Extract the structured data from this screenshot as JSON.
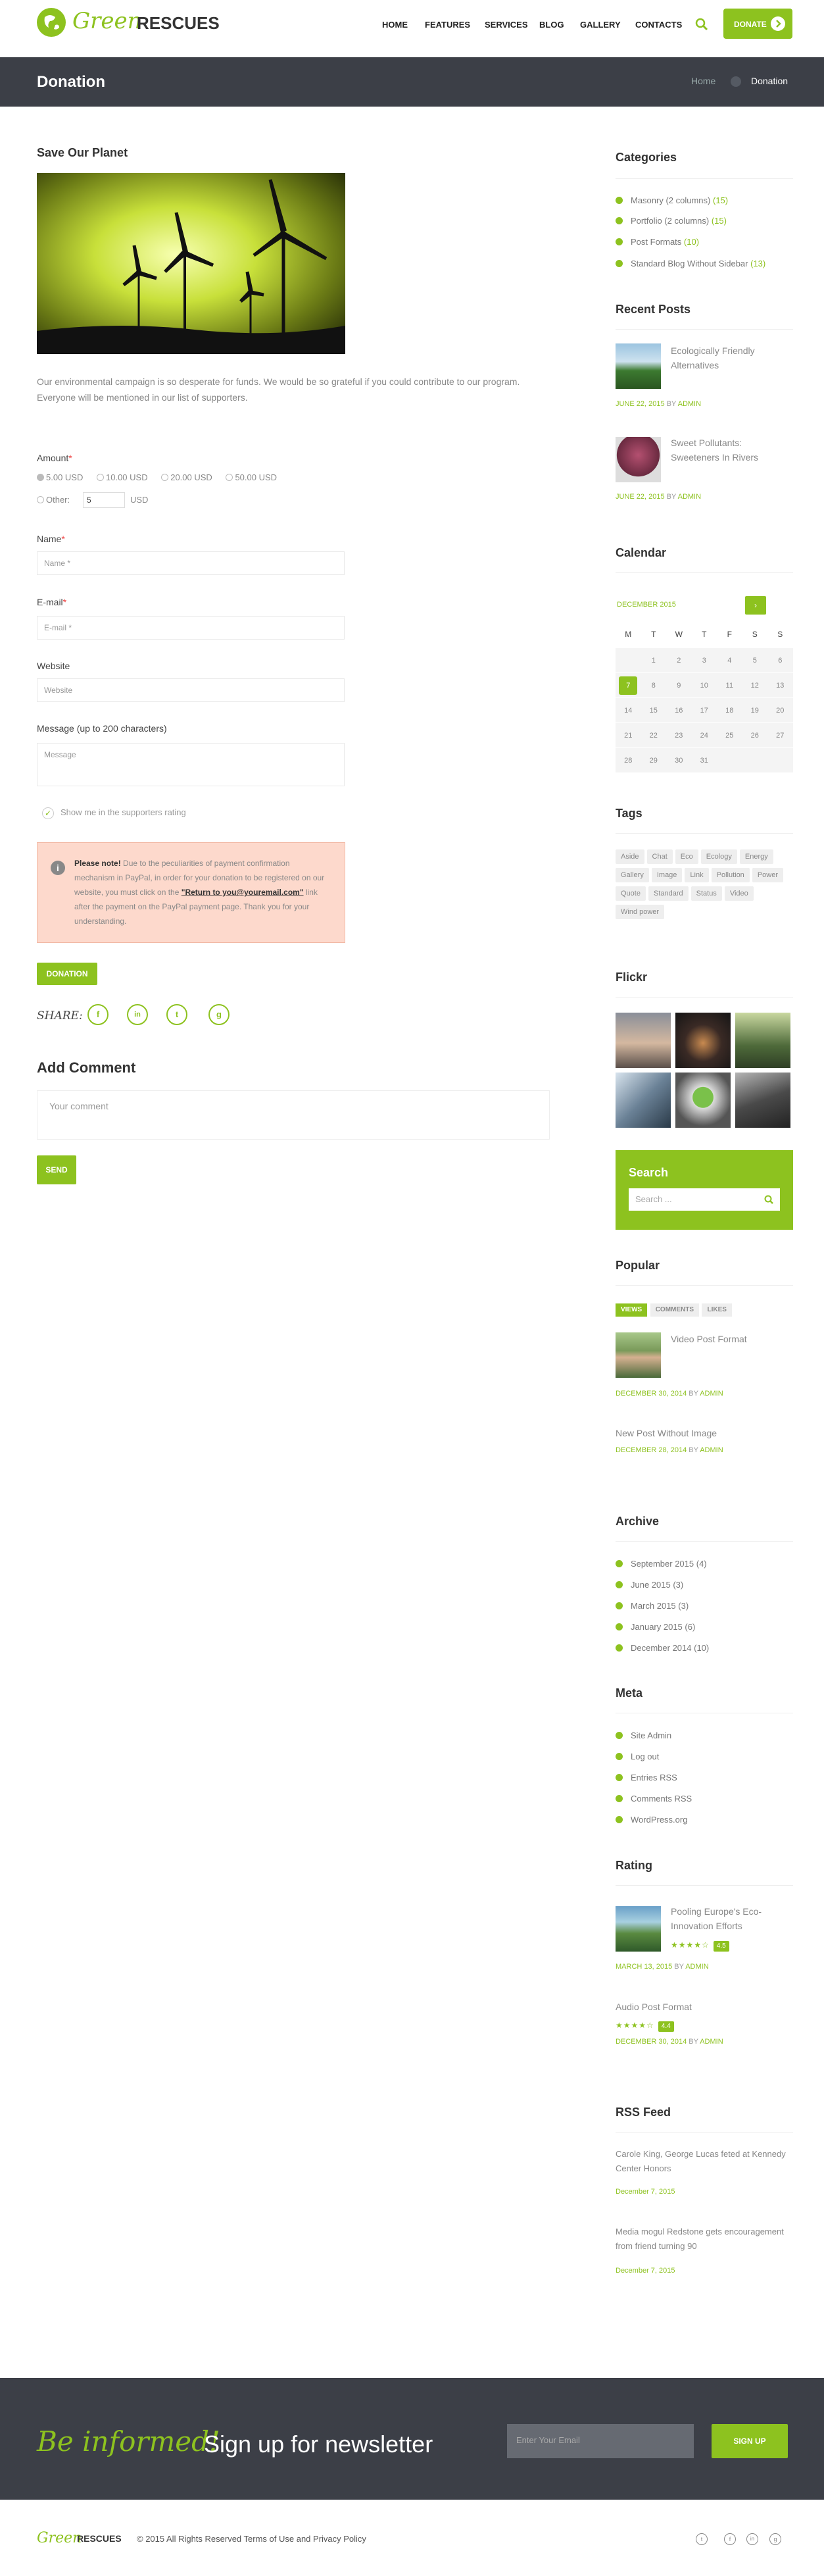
{
  "header": {
    "logo_green": "Green",
    "logo_dark": "RESCUES",
    "nav": [
      "HOME",
      "FEATURES",
      "SERVICES",
      "BLOG",
      "GALLERY",
      "CONTACTS"
    ],
    "donate_label": "DONATE"
  },
  "titlebar": {
    "title": "Donation",
    "breadcrumb_home": "Home",
    "breadcrumb_current": "Donation"
  },
  "main": {
    "heading": "Save Our Planet",
    "intro": "Our environmental campaign is so desperate for funds. We would be so grateful if you could contribute to our program. Everyone will be mentioned in our list of supporters.",
    "amount_label": "Amount",
    "amount_options": [
      "5.00 USD",
      "10.00 USD",
      "20.00 USD",
      "50.00 USD"
    ],
    "other_label": "Other:",
    "other_value": "5",
    "other_unit": "USD",
    "name_label": "Name",
    "name_placeholder": "Name *",
    "email_label": "E-mail",
    "email_placeholder": "E-mail *",
    "website_label": "Website",
    "website_placeholder": "Website",
    "message_label": "Message (up to 200 characters)",
    "message_placeholder": "Message",
    "checkbox_label": "Show me in the supporters rating",
    "notice_bold": "Please note!",
    "notice_text_1": " Due to the peculiarities of payment confirmation mechanism in PayPal, in order for your donation to be registered on our website, you must click on the ",
    "notice_link": "\"Return to you@youremail.com\"",
    "notice_text_2": " link after the payment on the PayPal payment page. Thank you for your understanding.",
    "donation_button": "DONATION",
    "share_label": "SHARE:",
    "share_icons": [
      "f",
      "in",
      "t",
      "g"
    ],
    "add_comment_title": "Add Comment",
    "comment_placeholder": "Your comment",
    "send_button": "SEND"
  },
  "sidebar": {
    "categories_title": "Categories",
    "categories": [
      {
        "name": "Masonry (2 columns)",
        "count": "(15)"
      },
      {
        "name": "Portfolio (2 columns)",
        "count": "(15)"
      },
      {
        "name": "Post Formats",
        "count": "(10)"
      },
      {
        "name": "Standard Blog Without Sidebar",
        "count": "(13)"
      }
    ],
    "recent_title": "Recent Posts",
    "recent": [
      {
        "title": "Ecologically Friendly Alternatives",
        "date": "JUNE 22, 2015",
        "by": "BY",
        "author": "ADMIN"
      },
      {
        "title": "Sweet Pollutants: Sweeteners In Rivers",
        "date": "JUNE 22, 2015",
        "by": "BY",
        "author": "ADMIN"
      }
    ],
    "calendar_title": "Calendar",
    "calendar_month": "DECEMBER 2015",
    "calendar_days": [
      "M",
      "T",
      "W",
      "T",
      "F",
      "S",
      "S"
    ],
    "calendar_rows": [
      [
        "",
        "1",
        "2",
        "3",
        "4",
        "5",
        "6"
      ],
      [
        "7",
        "8",
        "9",
        "10",
        "11",
        "12",
        "13"
      ],
      [
        "14",
        "15",
        "16",
        "17",
        "18",
        "19",
        "20"
      ],
      [
        "21",
        "22",
        "23",
        "24",
        "25",
        "26",
        "27"
      ],
      [
        "28",
        "29",
        "30",
        "31",
        "",
        "",
        ""
      ]
    ],
    "calendar_today": "7",
    "tags_title": "Tags",
    "tags": [
      "Aside",
      "Chat",
      "Eco",
      "Ecology",
      "Energy",
      "Gallery",
      "Image",
      "Link",
      "Pollution",
      "Power",
      "Quote",
      "Standard",
      "Status",
      "Video",
      "Wind power"
    ],
    "flickr_title": "Flickr",
    "search_title": "Search",
    "search_placeholder": "Search ...",
    "popular_title": "Popular",
    "popular_tabs": [
      "VIEWS",
      "COMMENTS",
      "LIKES"
    ],
    "popular": [
      {
        "title": "Video Post Format",
        "date": "DECEMBER 30, 2014",
        "by": "BY",
        "author": "ADMIN"
      },
      {
        "title": "New Post Without Image",
        "date": "DECEMBER 28, 2014",
        "by": "BY",
        "author": "ADMIN"
      }
    ],
    "archive_title": "Archive",
    "archive": [
      "September 2015 (4)",
      "June 2015 (3)",
      "March 2015 (3)",
      "January 2015 (6)",
      "December 2014 (10)"
    ],
    "meta_title": "Meta",
    "meta": [
      "Site Admin",
      "Log out",
      "Entries RSS",
      "Comments RSS",
      "WordPress.org"
    ],
    "rating_title": "Rating",
    "rating": [
      {
        "title": "Pooling Europe's Eco-Innovation Efforts",
        "score": "4.5",
        "date": "MARCH 13, 2015",
        "by": "BY",
        "author": "ADMIN"
      },
      {
        "title": "Audio Post Format",
        "score": "4.4",
        "date": "DECEMBER 30, 2014",
        "by": "BY",
        "author": "ADMIN"
      }
    ],
    "rss_title": "RSS Feed",
    "rss": [
      {
        "title": "Carole King, George Lucas feted at Kennedy Center Honors",
        "date": "December 7, 2015"
      },
      {
        "title": "Media mogul Redstone gets encouragement from friend turning 90",
        "date": "December 7, 2015"
      }
    ]
  },
  "newsletter": {
    "be_informed": "Be informed!",
    "signup": "Sign up for newsletter",
    "email_placeholder": "Enter Your Email",
    "button": "SIGN UP"
  },
  "footer": {
    "logo_green": "Green",
    "logo_dark": "RESCUES",
    "copyright": "© 2015 All Rights Reserved Terms of Use and Privacy Policy",
    "social": [
      "t",
      "f",
      "in",
      "g"
    ]
  },
  "colors": {
    "accent": "#8dc21f",
    "dark": "#3c3f47"
  }
}
